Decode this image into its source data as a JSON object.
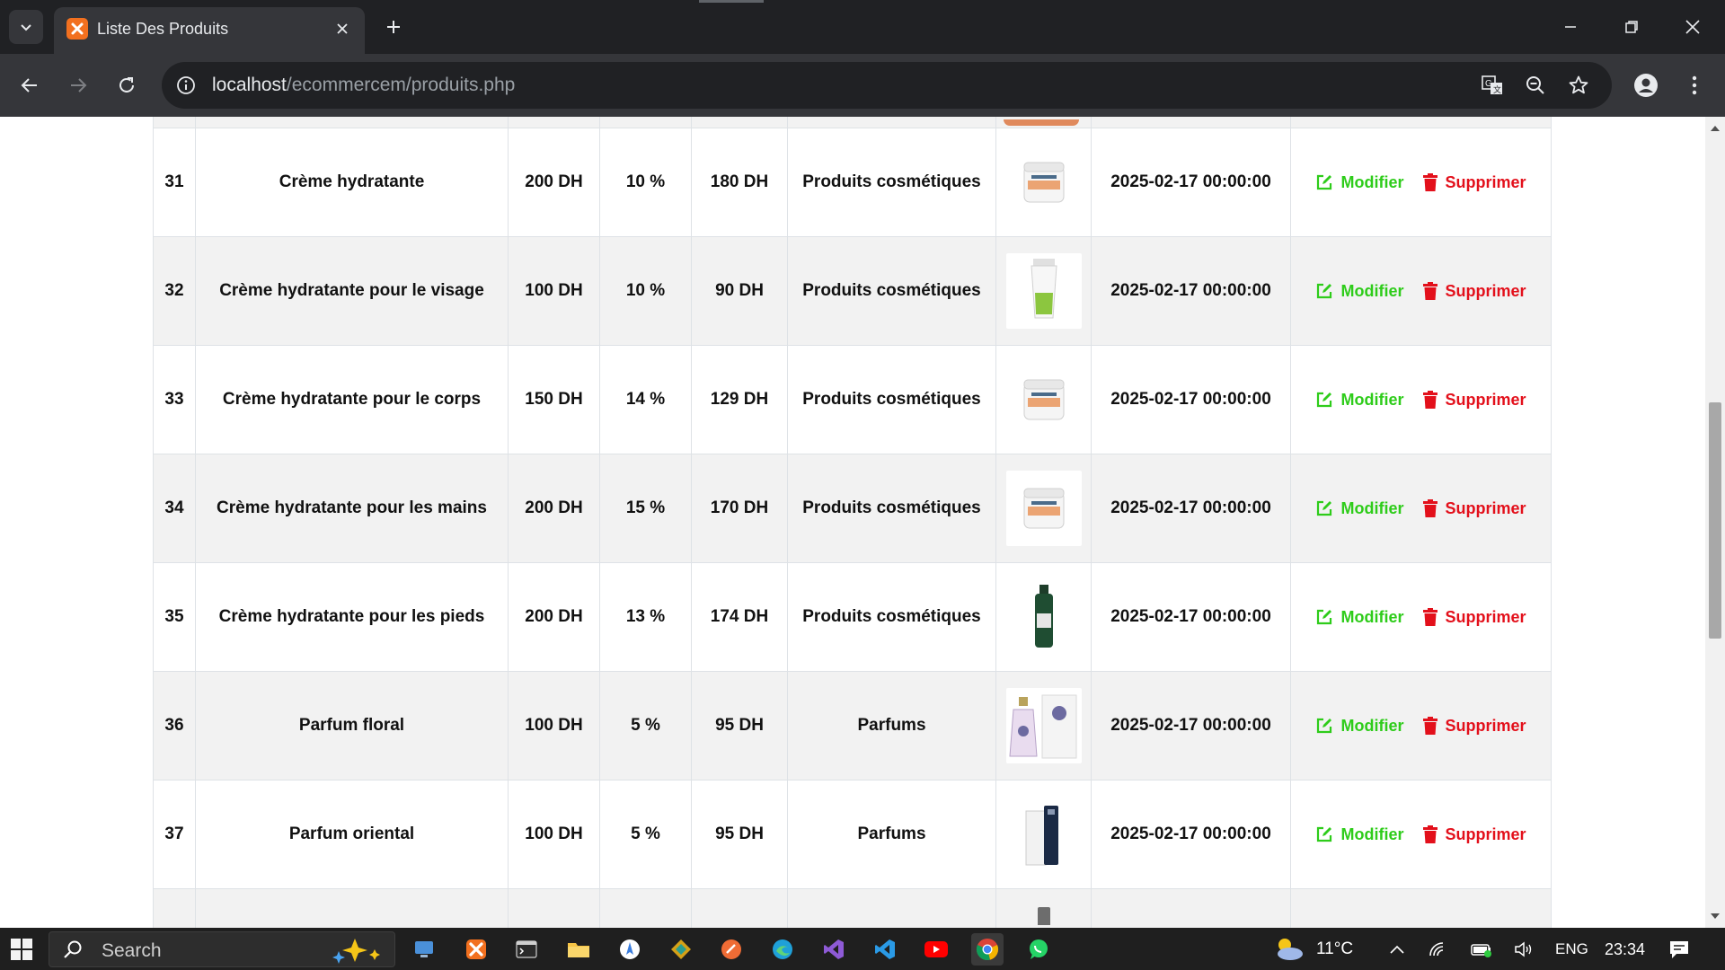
{
  "browser": {
    "tab_title": "Liste Des Produits",
    "url_host": "localhost",
    "url_path": "/ecommercem/produits.php"
  },
  "table": {
    "rows": [
      {
        "id": "31",
        "name": "Crème hydratante",
        "price": "200 DH",
        "discount": "10 %",
        "final_price": "180 DH",
        "category": "Produits cosmétiques",
        "image": "white-cream-jar",
        "date": "2025-02-17 00:00:00"
      },
      {
        "id": "32",
        "name": "Crème hydratante pour le visage",
        "price": "100 DH",
        "discount": "10 %",
        "final_price": "90 DH",
        "category": "Produits cosmétiques",
        "image": "green-cream-tube",
        "date": "2025-02-17 00:00:00"
      },
      {
        "id": "33",
        "name": "Crème hydratante pour le corps",
        "price": "150 DH",
        "discount": "14 %",
        "final_price": "129 DH",
        "category": "Produits cosmétiques",
        "image": "white-cream-jar",
        "date": "2025-02-17 00:00:00"
      },
      {
        "id": "34",
        "name": "Crème hydratante pour les mains",
        "price": "200 DH",
        "discount": "15 %",
        "final_price": "170 DH",
        "category": "Produits cosmétiques",
        "image": "white-cream-jar",
        "date": "2025-02-17 00:00:00"
      },
      {
        "id": "35",
        "name": "Crème hydratante pour les pieds",
        "price": "200 DH",
        "discount": "13 %",
        "final_price": "174 DH",
        "category": "Produits cosmétiques",
        "image": "green-bottle",
        "date": "2025-02-17 00:00:00"
      },
      {
        "id": "36",
        "name": "Parfum floral",
        "price": "100 DH",
        "discount": "5 %",
        "final_price": "95 DH",
        "category": "Parfums",
        "image": "perfume-bottle-box",
        "date": "2025-02-17 00:00:00"
      },
      {
        "id": "37",
        "name": "Parfum oriental",
        "price": "100 DH",
        "discount": "5 %",
        "final_price": "95 DH",
        "category": "Parfums",
        "image": "dark-perfume-box",
        "date": "2025-02-17 00:00:00"
      }
    ],
    "edit_label": "Modifier",
    "delete_label": "Supprimer",
    "edit_color": "#2ecc1a",
    "delete_color": "#e3101b"
  },
  "taskbar": {
    "search_label": "Search",
    "weather": "11°C",
    "language": "ENG",
    "time": "23:34"
  }
}
